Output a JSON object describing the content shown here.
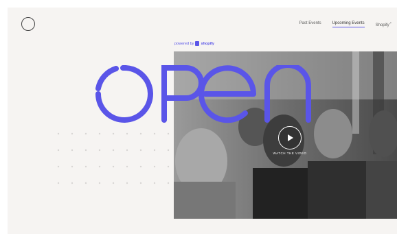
{
  "nav": {
    "items": [
      {
        "label": "Past Events"
      },
      {
        "label": "Upcoming Events"
      },
      {
        "label": "Shopify"
      }
    ]
  },
  "powered_by": {
    "prefix": "powered by",
    "brand": "shopify"
  },
  "hero": {
    "word": "OPEN",
    "video_cta": "WATCH THE VIDEO"
  },
  "colors": {
    "accent": "#5a55e8",
    "background": "#f6f4f2"
  }
}
